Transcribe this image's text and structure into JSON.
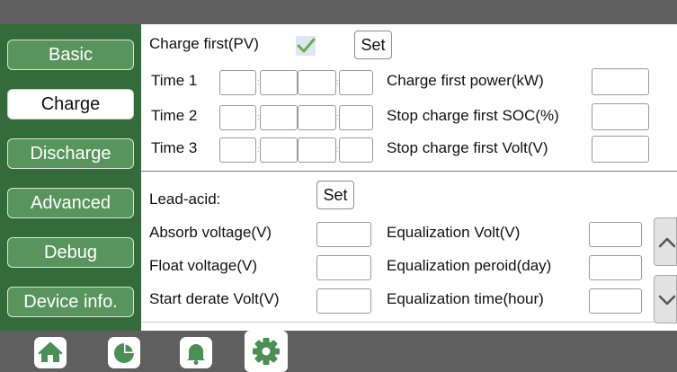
{
  "sidebar": {
    "items": [
      {
        "label": "Basic"
      },
      {
        "label": "Charge"
      },
      {
        "label": "Discharge"
      },
      {
        "label": "Advanced"
      },
      {
        "label": "Debug"
      },
      {
        "label": "Device info."
      }
    ]
  },
  "charge_section": {
    "charge_first_label": "Charge first(PV)",
    "charge_first_checked": true,
    "set_label": "Set",
    "time1_label": "Time 1",
    "time2_label": "Time 2",
    "time3_label": "Time 3",
    "time_separator": ":",
    "charge_first_power_label": "Charge first power(kW)",
    "stop_charge_soc_label": "Stop charge first SOC(%)",
    "stop_charge_volt_label": "Stop charge first Volt(V)"
  },
  "lead_acid_section": {
    "lead_acid_label": "Lead-acid:",
    "set_label": "Set",
    "absorb_voltage_label": "Absorb voltage(V)",
    "float_voltage_label": "Float voltage(V)",
    "start_derate_volt_label": "Start derate Volt(V)",
    "equalization_volt_label": "Equalization Volt(V)",
    "equalization_period_label": "Equalization peroid(day)",
    "equalization_time_label": "Equalization time(hour)"
  },
  "bottom_nav": {
    "items": [
      {
        "icon": "home-icon"
      },
      {
        "icon": "pie-chart-icon"
      },
      {
        "icon": "bell-icon"
      },
      {
        "icon": "gear-icon",
        "active": true
      }
    ]
  },
  "colors": {
    "sidebar_bg": "#336b3b",
    "nav_button": "#58955d",
    "bar_gray": "#5f5f5f",
    "check_green": "#5fb24a",
    "icon_green": "#4a8f53"
  }
}
